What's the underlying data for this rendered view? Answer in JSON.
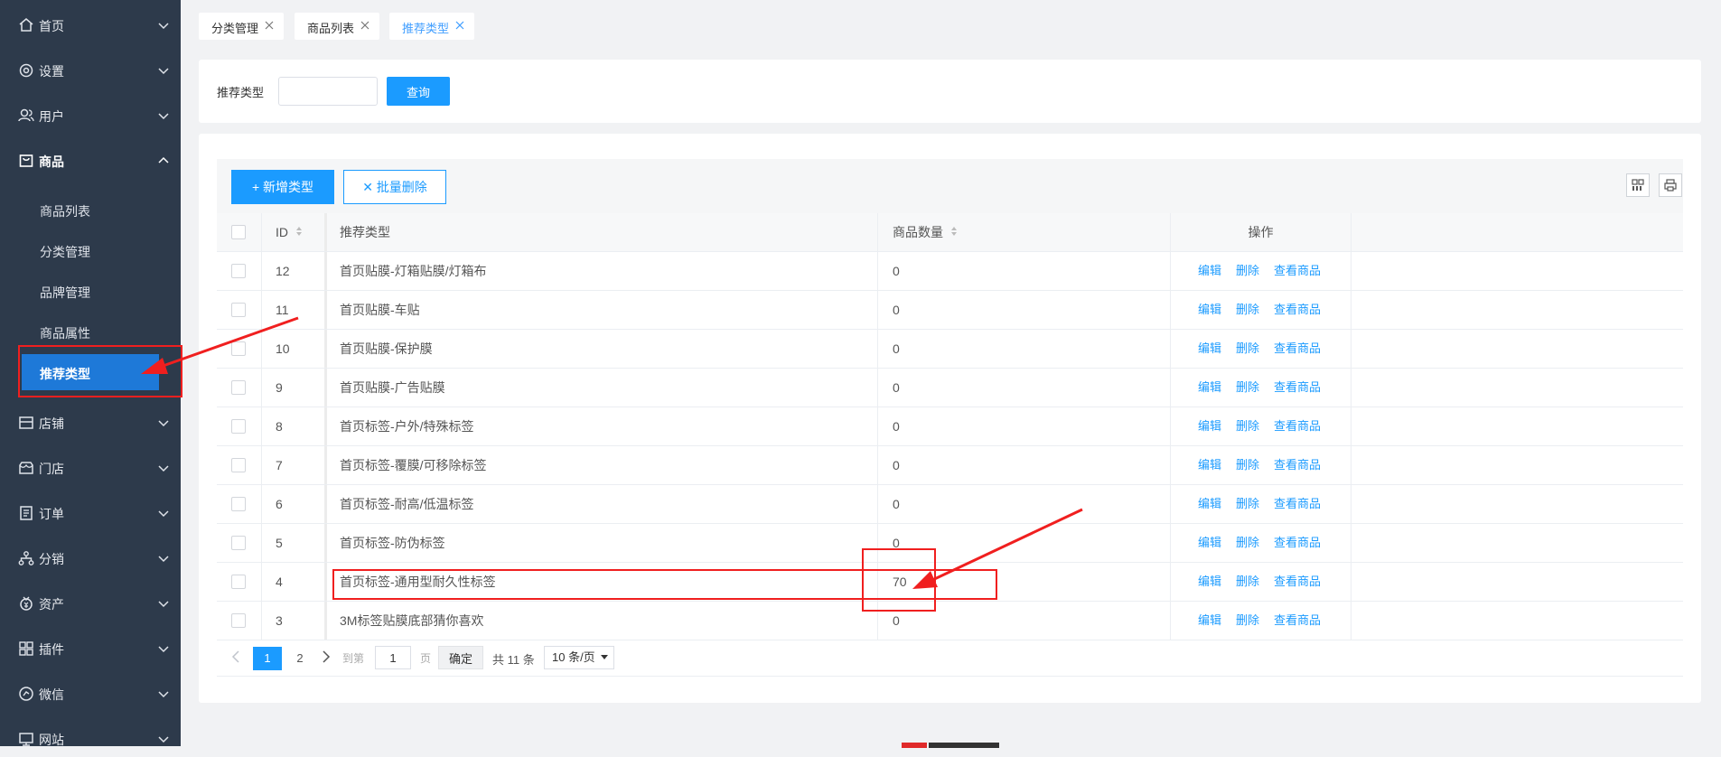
{
  "sidebar": {
    "items": [
      {
        "label": "首页",
        "icon": "home-icon"
      },
      {
        "label": "设置",
        "icon": "settings-icon"
      },
      {
        "label": "用户",
        "icon": "users-icon"
      },
      {
        "label": "商品",
        "icon": "product-bag-icon",
        "expanded": true,
        "children": [
          {
            "label": "商品列表"
          },
          {
            "label": "分类管理"
          },
          {
            "label": "品牌管理"
          },
          {
            "label": "商品属性"
          },
          {
            "label": "推荐类型",
            "active": true
          }
        ]
      },
      {
        "label": "店铺",
        "icon": "shop-icon"
      },
      {
        "label": "门店",
        "icon": "store-icon"
      },
      {
        "label": "订单",
        "icon": "order-icon"
      },
      {
        "label": "分销",
        "icon": "distribution-icon"
      },
      {
        "label": "资产",
        "icon": "asset-icon"
      },
      {
        "label": "插件",
        "icon": "plugin-icon"
      },
      {
        "label": "微信",
        "icon": "wechat-icon"
      },
      {
        "label": "网站",
        "icon": "website-icon"
      }
    ]
  },
  "tabs": [
    {
      "label": "分类管理"
    },
    {
      "label": "商品列表"
    },
    {
      "label": "推荐类型",
      "active": true
    }
  ],
  "search": {
    "label": "推荐类型",
    "value": "",
    "button": "查询"
  },
  "toolbar": {
    "add_label": "+ 新增类型",
    "batch_delete_label": "✕ 批量删除"
  },
  "table": {
    "headers": {
      "id": "ID",
      "type": "推荐类型",
      "count": "商品数量",
      "ops": "操作"
    },
    "op_labels": {
      "edit": "编辑",
      "delete": "删除",
      "view": "查看商品"
    },
    "rows": [
      {
        "id": "12",
        "type": "首页贴膜-灯箱贴膜/灯箱布",
        "count": "0"
      },
      {
        "id": "11",
        "type": "首页贴膜-车贴",
        "count": "0"
      },
      {
        "id": "10",
        "type": "首页贴膜-保护膜",
        "count": "0"
      },
      {
        "id": "9",
        "type": "首页贴膜-广告贴膜",
        "count": "0"
      },
      {
        "id": "8",
        "type": "首页标签-户外/特殊标签",
        "count": "0"
      },
      {
        "id": "7",
        "type": "首页标签-覆膜/可移除标签",
        "count": "0"
      },
      {
        "id": "6",
        "type": "首页标签-耐高/低温标签",
        "count": "0"
      },
      {
        "id": "5",
        "type": "首页标签-防伪标签",
        "count": "0"
      },
      {
        "id": "4",
        "type": "首页标签-通用型耐久性标签",
        "count": "70"
      },
      {
        "id": "3",
        "type": "3M标签贴膜底部猜你喜欢",
        "count": "0"
      }
    ]
  },
  "pagination": {
    "pages": [
      "1",
      "2"
    ],
    "current": "1",
    "goto_label": "到第",
    "goto_value": "1",
    "page_unit": "页",
    "confirm": "确定",
    "total": "共 11 条",
    "per_page": "10 条/页"
  },
  "colors": {
    "sidebar_bg": "#2d3a4b",
    "accent": "#1b9bff",
    "active_menu": "#1e79d8",
    "annotation_red": "#f01f1f"
  }
}
